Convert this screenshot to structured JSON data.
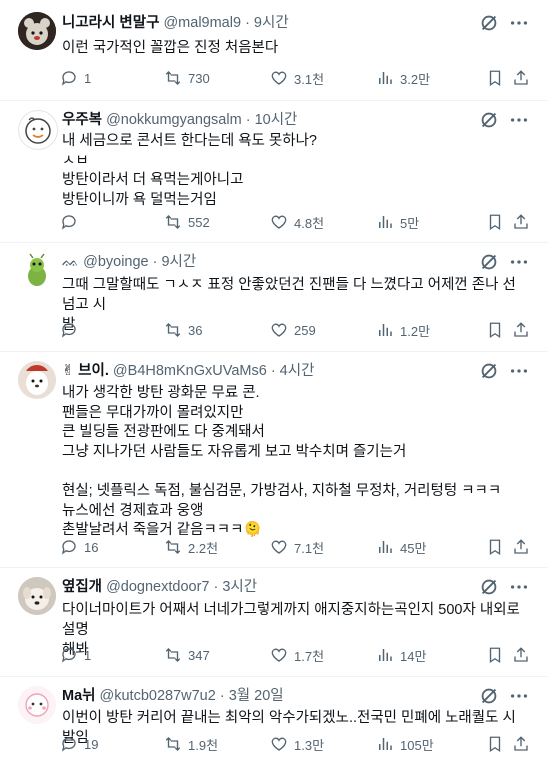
{
  "posts": [
    {
      "name": "니고라시 변말구",
      "handle": "@mal9mal9",
      "time": "· 9시간",
      "text": "이런 국가적인 꼴깝은 진정 처음본다",
      "replies": "1",
      "reposts": "730",
      "likes": "3.1천",
      "views": "3.2만",
      "avatar_icon": "bear-avatar"
    },
    {
      "name": "우주복",
      "handle": "@nokkumgyangsalm",
      "time": "· 10시간",
      "text": "내 세금으로 콘서트 한다는데 욕도 못하나?\nㅅㅂ\n방탄이라서 더 욕먹는게아니고\n방탄이니까 욕 덜먹는거임",
      "replies": "",
      "reposts": "552",
      "likes": "4.8천",
      "views": "5만",
      "avatar_icon": "doodle-face-avatar"
    },
    {
      "name": "",
      "handle": "ᨐ @byoinge",
      "time": "· 9시간",
      "text": "그때 그말할때도 ㄱㅅㅈ 표정 안좋았던건 진팬들 다 느꼈다고 어제껀 존나 선넘고 시\n발",
      "replies": "",
      "reposts": "36",
      "likes": "259",
      "views": "1.2만",
      "avatar_icon": "green-bug-avatar"
    },
    {
      "name": "✌ 브이.",
      "handle": "@B4H8mKnGxUVaMs6",
      "time": "· 4시간",
      "text": "내가 생각한 방탄 광화문 무료 콘.\n팬들은 무대가까이 몰려있지만\n큰 빌딩들 전광판에도 다 중계돼서\n그냥 지나가던 사람들도 자유롭게 보고 박수치며 즐기는거\n\n현실; 넷플릭스 독점, 불심검문, 가방검사, 지하철 무정차, 거리텅텅 ㅋㅋㅋ\n뉴스에선 경제효과 웅앵\n촌발날려서 죽을거 같음ㅋㅋㅋ🫠",
      "replies": "16",
      "reposts": "2.2천",
      "likes": "7.1천",
      "views": "45만",
      "avatar_icon": "white-dog-avatar"
    },
    {
      "name": "옆집개",
      "handle": "@dognextdoor7",
      "time": "· 3시간",
      "text": "다이너마이트가 어째서 너네가그렇게까지 애지중지하는곡인지 500자 내외로 설명\n해봐",
      "replies": "1",
      "reposts": "347",
      "likes": "1.7천",
      "views": "14만",
      "avatar_icon": "dog-photo-avatar"
    },
    {
      "name": "Ma뉘",
      "handle": "@kutcb0287w7u2",
      "time": "· 3월 20일",
      "text": "이번이 방탄 커리어 끝내는 최악의 악수가되겠노..전국민 민폐에 노래퀄도 시발임",
      "replies": "19",
      "reposts": "1.9천",
      "likes": "1.3만",
      "views": "105만",
      "avatar_icon": "pink-character-avatar"
    }
  ],
  "colors": {
    "text": "#0f1419",
    "muted": "#536471",
    "divider": "#eff3f4"
  }
}
